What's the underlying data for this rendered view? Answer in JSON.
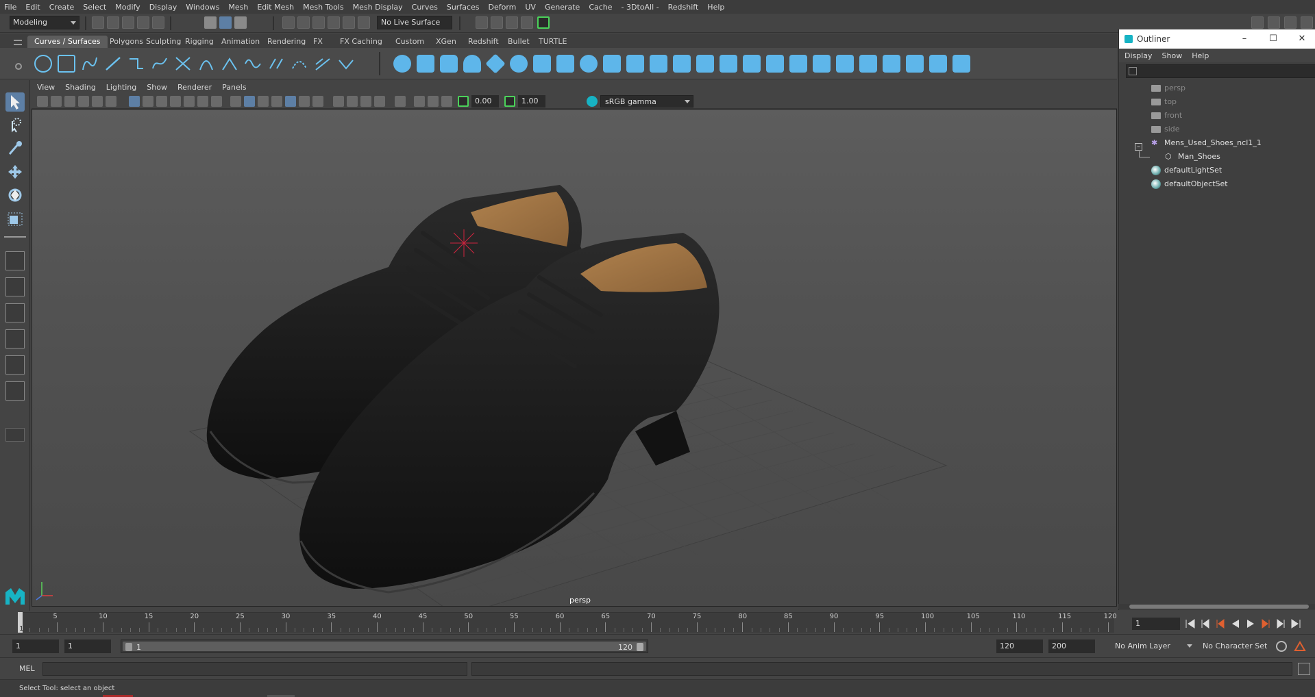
{
  "menubar": [
    "File",
    "Edit",
    "Create",
    "Select",
    "Modify",
    "Display",
    "Windows",
    "Mesh",
    "Edit Mesh",
    "Mesh Tools",
    "Mesh Display",
    "Curves",
    "Surfaces",
    "Deform",
    "UV",
    "Generate",
    "Cache",
    "- 3DtoAll -",
    "Redshift",
    "Help"
  ],
  "statusline": {
    "mode": "Modeling",
    "live_surface": "No Live Surface"
  },
  "shelf_tabs": [
    "Curves / Surfaces",
    "Polygons",
    "Sculpting",
    "Rigging",
    "Animation",
    "Rendering",
    "FX",
    "FX Caching",
    "Custom",
    "XGen",
    "Redshift",
    "Bullet",
    "TURTLE"
  ],
  "viewport_menu": [
    "View",
    "Shading",
    "Lighting",
    "Show",
    "Renderer",
    "Panels"
  ],
  "viewport_toolbar": {
    "exposure": "0.00",
    "gamma_value": "1.00",
    "color_space": "sRGB gamma"
  },
  "viewport": {
    "camera_label": "persp"
  },
  "outliner": {
    "title": "Outliner",
    "menu": [
      "Display",
      "Show",
      "Help"
    ],
    "items": [
      {
        "label": "persp",
        "kind": "camera"
      },
      {
        "label": "top",
        "kind": "camera"
      },
      {
        "label": "front",
        "kind": "camera"
      },
      {
        "label": "side",
        "kind": "camera"
      },
      {
        "label": "Mens_Used_Shoes_ncl1_1",
        "kind": "group"
      },
      {
        "label": "Man_Shoes",
        "kind": "mesh"
      },
      {
        "label": "defaultLightSet",
        "kind": "set"
      },
      {
        "label": "defaultObjectSet",
        "kind": "set"
      }
    ],
    "window_buttons": {
      "minimize": "–",
      "maximize": "☐",
      "close": "✕"
    }
  },
  "timeslider": {
    "current_frame": "1",
    "labels": [
      "5",
      "10",
      "15",
      "20",
      "25",
      "30",
      "35",
      "40",
      "45",
      "50",
      "55",
      "60",
      "65",
      "70",
      "75",
      "80",
      "85",
      "90",
      "95",
      "100",
      "105",
      "110",
      "115",
      "120"
    ],
    "frame_field": "1"
  },
  "range": {
    "start": "1",
    "playback_start": "1",
    "range_start_label": "1",
    "range_end_label": "120",
    "playback_end": "120",
    "end": "200",
    "anim_layer": "No Anim Layer",
    "character_set": "No Character Set"
  },
  "cmdline": {
    "label": "MEL"
  },
  "helpline": {
    "text": "Select Tool: select an object"
  },
  "colors": {
    "accent": "#5d7fa5",
    "shelf_blue": "#5eb6ea",
    "maya_teal": "#17b3c4"
  }
}
